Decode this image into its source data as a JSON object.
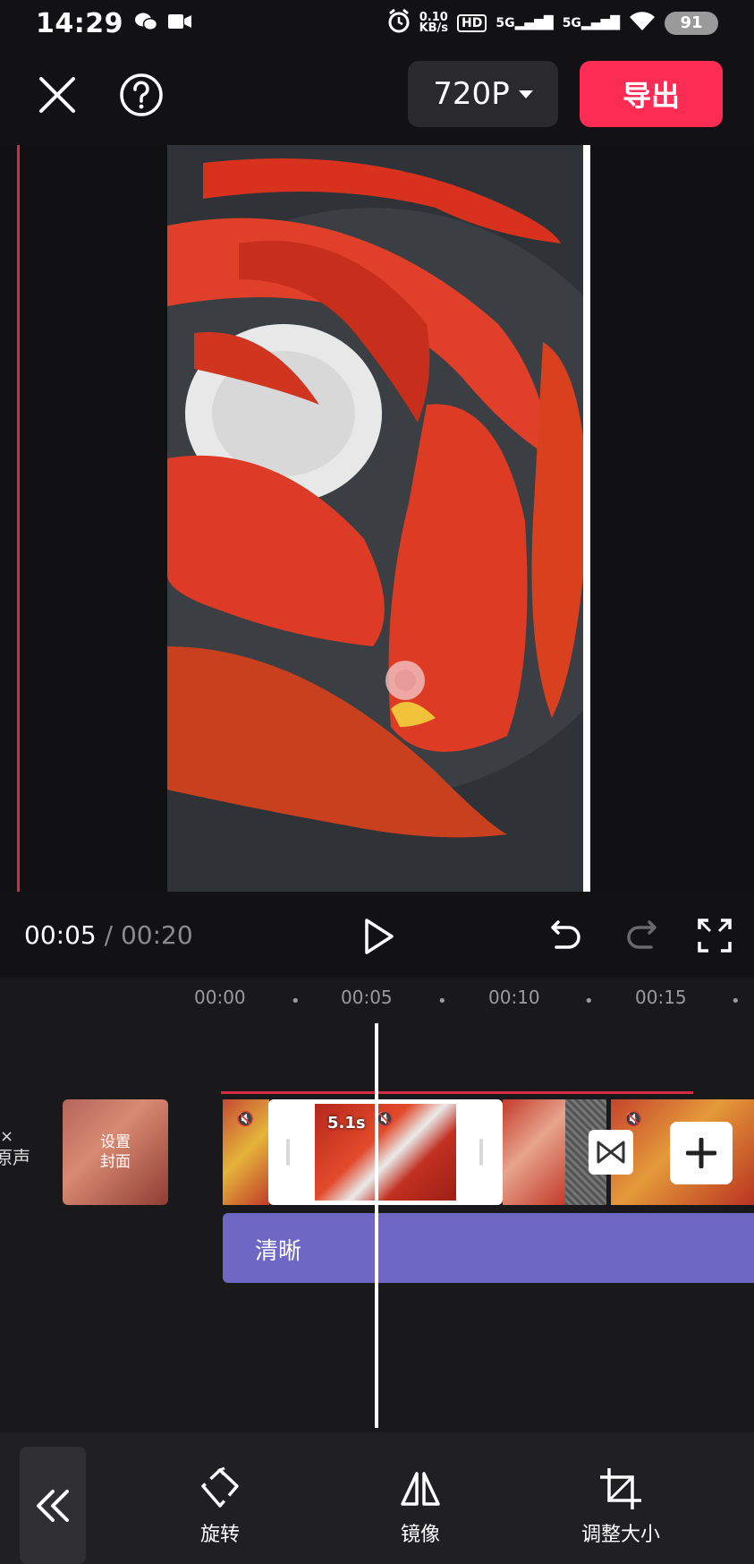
{
  "status": {
    "time": "14:29",
    "speed_value": "0.10",
    "speed_unit": "KB/s",
    "hd": "HD",
    "sim1": "5G",
    "sim2": "5G",
    "battery": "91"
  },
  "topbar": {
    "resolution": "720P",
    "export_label": "导出"
  },
  "playback": {
    "current_time": "00:05",
    "separator": "/",
    "total_time": "00:20"
  },
  "ruler": {
    "ticks": [
      "00:00",
      "00:05",
      "00:10",
      "00:15"
    ],
    "dot": "•"
  },
  "timeline": {
    "track_mute_label_line1": "×",
    "track_mute_label_line2": "原声",
    "cover_line1": "设置",
    "cover_line2": "封面",
    "selected_clip_duration": "5.1s",
    "effect_label": "清晰"
  },
  "toolbar": {
    "rotate_label": "旋转",
    "mirror_label": "镜像",
    "resize_label": "调整大小"
  },
  "colors": {
    "accent": "#fd2c55",
    "effect_track": "#6e67c3",
    "background": "#121214"
  }
}
